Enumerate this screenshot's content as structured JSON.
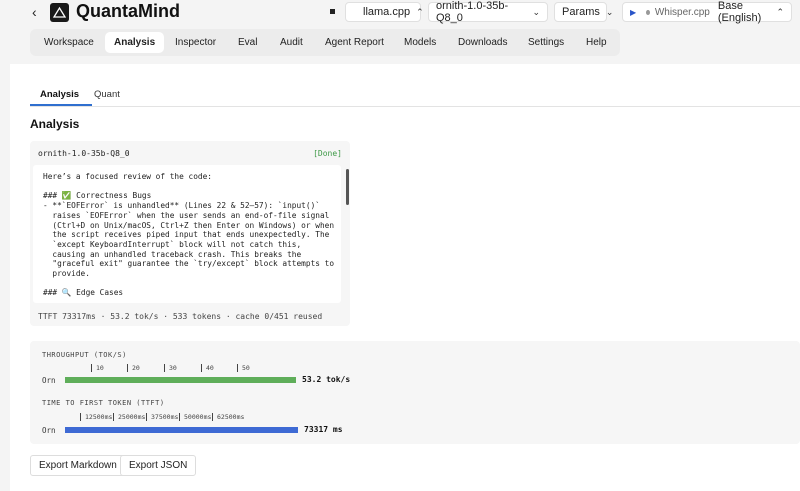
{
  "header": {
    "back_glyph": "‹",
    "brand": "QuantaMind",
    "backend": "llama.cpp",
    "model": "ornith-1.0-35b-Q8_0",
    "params": "Params",
    "whisper_label": "Whisper.cpp",
    "whisper_model": "Base (English)"
  },
  "nav": {
    "items": [
      {
        "label": "Workspace"
      },
      {
        "label": "Analysis"
      },
      {
        "label": "Inspector"
      },
      {
        "label": "Eval"
      },
      {
        "label": "Audit"
      },
      {
        "label": "Agent Report"
      },
      {
        "label": "Models"
      },
      {
        "label": "Downloads"
      },
      {
        "label": "Settings"
      },
      {
        "label": "Help"
      }
    ],
    "active": "Analysis"
  },
  "subtabs": [
    {
      "label": "Analysis"
    },
    {
      "label": "Quant"
    }
  ],
  "section_title": "Analysis",
  "result": {
    "model": "ornith-1.0-35b-Q8_0",
    "status": "[Done]",
    "text": "Here’s a focused review of the code:\n\n### ✅ Correctness Bugs\n- **`EOFError` is unhandled** (Lines 22 & 52–57): `input()`\n  raises `EOFError` when the user sends an end-of-file signal\n  (Ctrl+D on Unix/macOS, Ctrl+Z then Enter on Windows) or when\n  the script receives piped input that ends unexpectedly. The\n  `except KeyboardInterrupt` block will not catch this,\n  causing an unhandled traceback crash. This breaks the\n  \"graceful exit\" guarantee the `try/except` block attempts to\n  provide.\n\n### 🔍 Edge Cases",
    "stats": "TTFT 73317ms · 53.2 tok/s · 533 tokens · cache 0/451 reused"
  },
  "metrics": {
    "throughput": {
      "title": "THROUGHPUT (TOK/S)",
      "ticks": [
        "10",
        "20",
        "30",
        "40",
        "50"
      ],
      "row_label": "Orn",
      "value_label": "53.2 tok/s",
      "value": 53.2,
      "color": "#5fae5a"
    },
    "ttft": {
      "title": "TIME TO FIRST TOKEN (TTFT)",
      "ticks": [
        "12500ms",
        "25000ms",
        "37500ms",
        "50000ms",
        "62500ms"
      ],
      "row_label": "Orn",
      "value_label": "73317 ms",
      "value": 73317,
      "color": "#3e6ad4"
    }
  },
  "buttons": {
    "export_markdown": "Export Markdown",
    "export_json": "Export JSON"
  }
}
